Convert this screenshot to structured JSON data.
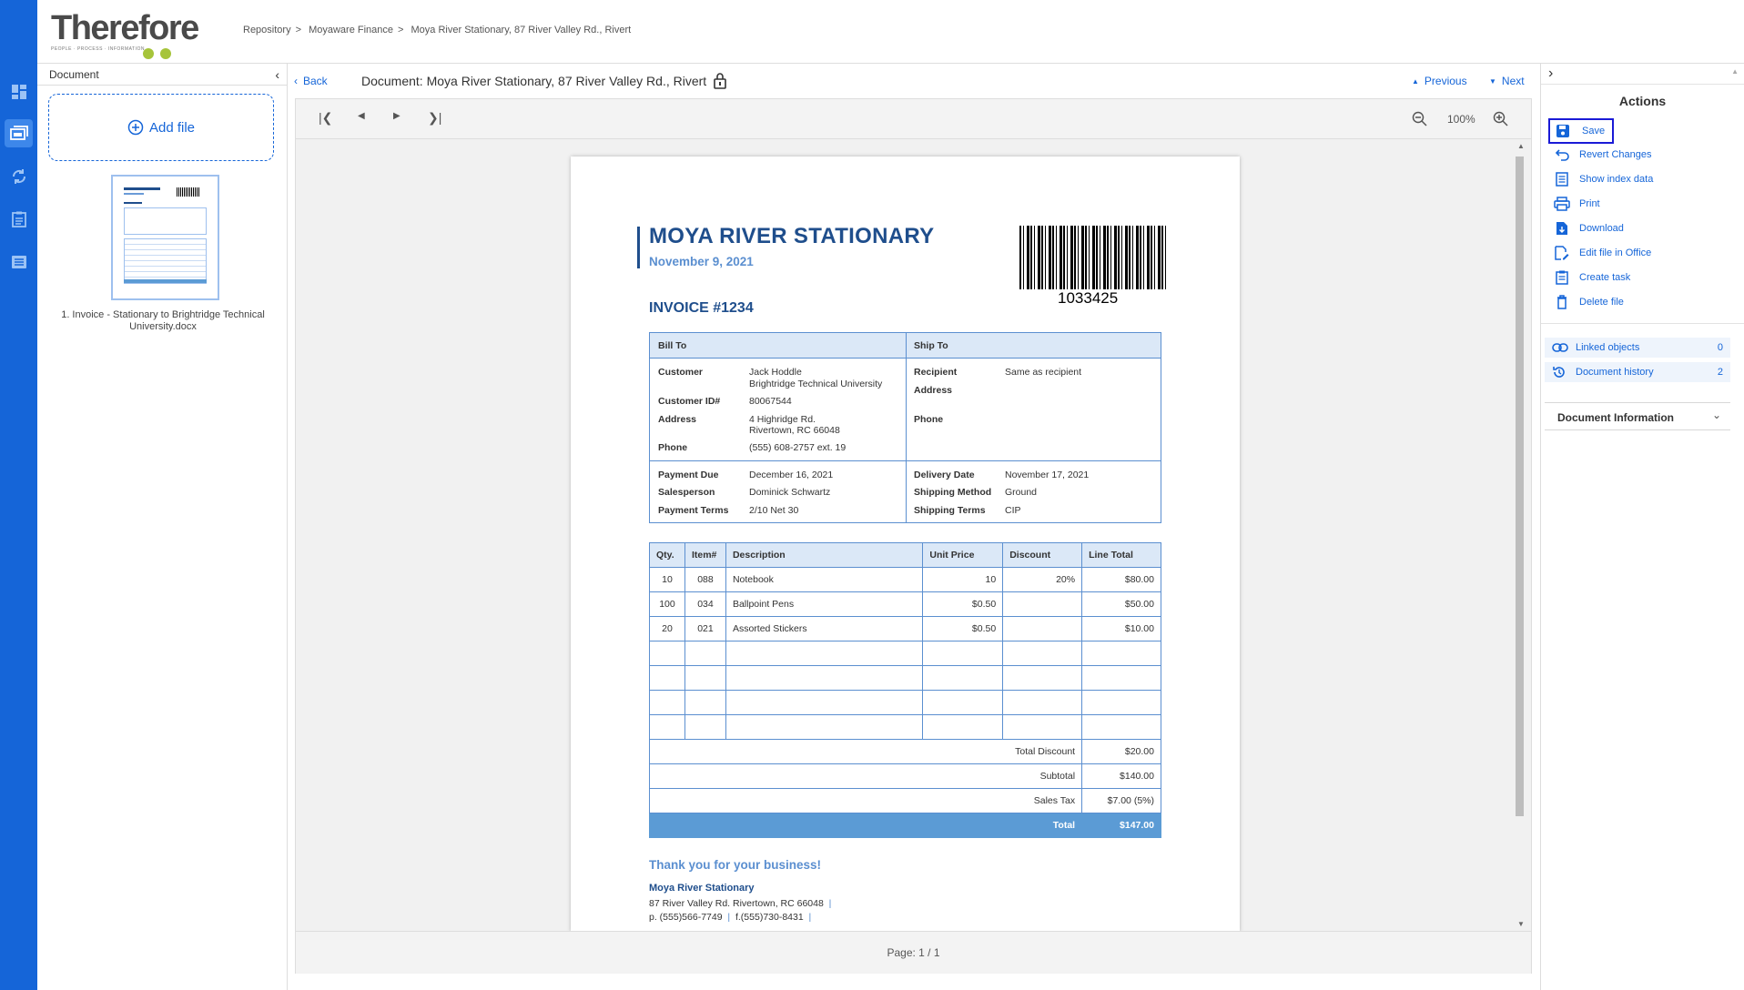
{
  "app": {
    "name": "Therefore",
    "tagline": "PEOPLE · PROCESS · INFORMATION"
  },
  "breadcrumb": [
    "Repository",
    "Moyaware Finance",
    "Moya River Stationary, 87 River Valley Rd., Rivert"
  ],
  "left_panel": {
    "title": "Document",
    "add_file": "Add file",
    "file_label": "1. Invoice - Stationary to Brightridge Technical University.docx"
  },
  "viewer": {
    "back": "Back",
    "doc_title": "Document: Moya River Stationary, 87 River Valley Rd., Rivert",
    "previous": "Previous",
    "next": "Next",
    "zoom": "100%",
    "page_indicator": "Page: 1 / 1"
  },
  "invoice": {
    "company": "MOYA RIVER STATIONARY",
    "date": "November 9, 2021",
    "barcode_number": "1033425",
    "invoice_no": "INVOICE #1234",
    "bill_to_header": "Bill To",
    "ship_to_header": "Ship To",
    "bill": {
      "customer_label": "Customer",
      "customer_name": "Jack Hoddle",
      "customer_org": "Brightridge Technical University",
      "customer_id_label": "Customer ID#",
      "customer_id": "80067544",
      "address_label": "Address",
      "address_1": "4 Highridge Rd.",
      "address_2": "Rivertown, RC 66048",
      "phone_label": "Phone",
      "phone": "(555) 608-2757 ext. 19"
    },
    "ship": {
      "recipient_label": "Recipient",
      "recipient": "Same as recipient",
      "address_label": "Address",
      "phone_label": "Phone"
    },
    "terms": {
      "payment_due_label": "Payment Due",
      "payment_due": "December 16, 2021",
      "salesperson_label": "Salesperson",
      "salesperson": "Dominick Schwartz",
      "payment_terms_label": "Payment Terms",
      "payment_terms": "2/10 Net 30",
      "delivery_date_label": "Delivery Date",
      "delivery_date": "November 17, 2021",
      "shipping_method_label": "Shipping Method",
      "shipping_method": "Ground",
      "shipping_terms_label": "Shipping Terms",
      "shipping_terms": "CIP"
    },
    "items_headers": [
      "Qty.",
      "Item#",
      "Description",
      "Unit Price",
      "Discount",
      "Line Total"
    ],
    "items": [
      [
        "10",
        "088",
        "Notebook",
        "10",
        "20%",
        "$80.00"
      ],
      [
        "100",
        "034",
        "Ballpoint Pens",
        "$0.50",
        "",
        "$50.00"
      ],
      [
        "20",
        "021",
        "Assorted Stickers",
        "$0.50",
        "",
        "$10.00"
      ],
      [
        "",
        "",
        "",
        "",
        "",
        ""
      ],
      [
        "",
        "",
        "",
        "",
        "",
        ""
      ],
      [
        "",
        "",
        "",
        "",
        "",
        ""
      ],
      [
        "",
        "",
        "",
        "",
        "",
        ""
      ]
    ],
    "totals": {
      "total_discount_label": "Total Discount",
      "total_discount": "$20.00",
      "subtotal_label": "Subtotal",
      "subtotal": "$140.00",
      "sales_tax_label": "Sales Tax",
      "sales_tax": "$7.00 (5%)",
      "total_label": "Total",
      "total": "$147.00"
    },
    "thanks": "Thank you for your business!",
    "footer_company": "Moya River Stationary",
    "footer_address": "87 River Valley Rd. Rivertown, RC 66048",
    "footer_phone": "p. (555)566-7749",
    "footer_fax": "f.(555)730-8431"
  },
  "actions": {
    "title": "Actions",
    "items": [
      "Save",
      "Revert Changes",
      "Show index data",
      "Print",
      "Download",
      "Edit file in Office",
      "Create task",
      "Delete file"
    ],
    "linked_objects": "Linked objects",
    "linked_objects_count": "0",
    "document_history": "Document history",
    "document_history_count": "2",
    "document_information": "Document Information"
  },
  "colors": {
    "brand": "#1565d8",
    "doc_blue": "#1f4e8c",
    "table_border": "#5b8fd0",
    "total_bar": "#5b9bd5",
    "logo_green": "#a6c43a"
  }
}
